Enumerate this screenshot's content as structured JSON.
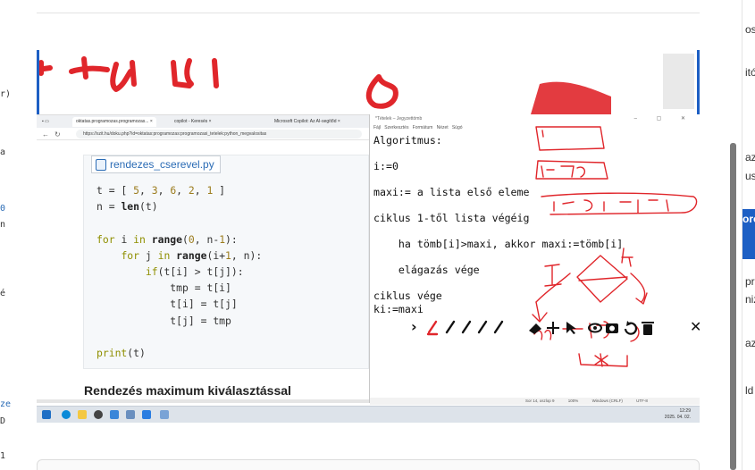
{
  "left_fragments": [
    {
      "text": "r)"
    },
    {
      "text": "a"
    },
    {
      "text": "0"
    },
    {
      "text": "n"
    },
    {
      "text": "é"
    },
    {
      "text": "ze"
    },
    {
      "text": "D"
    },
    {
      "text": "1"
    }
  ],
  "right_sidebar": {
    "items": [
      "os",
      "itó",
      "az",
      "us",
      "oro",
      "pr",
      "niz",
      "aza",
      "ld"
    ]
  },
  "browser": {
    "tabs": [
      {
        "label": "oktatas.programozas.programozas...",
        "close": "×"
      },
      {
        "label": "copilot - Keresés",
        "close": "×"
      },
      {
        "label": "Microsoft Copilot: Az AI-segítőd",
        "close": "×"
      }
    ],
    "url": "https://szit.hu/doku.php?id=oktatas:programozas:programozasi_tetelek:python_megvalositas",
    "filename": "rendezes_cserevel.py",
    "heading": "Rendezés maximum kiválasztással"
  },
  "code_lines": [
    "t = [ 5, 3, 6, 2, 1 ]",
    "n = len(t)",
    "",
    "for i in range(0, n-1):",
    "    for j in range(i+1, n):",
    "        if(t[i] > t[j]):",
    "            tmp = t[i]",
    "            t[i] = t[j]",
    "            t[j] = tmp",
    "",
    "print(t)"
  ],
  "notepad": {
    "title": "*Tételek – Jegyzettömb",
    "window_buttons": "–  ▢  ✕",
    "menu": [
      "Fájl",
      "Szerkesztés",
      "Formátum",
      "Nézet",
      "Súgó"
    ],
    "lines": [
      "Algoritmus:",
      "",
      "i:=0",
      "",
      "maxi:= a lista első eleme",
      "",
      "ciklus 1-től lista végéig",
      "",
      "    ha tömb[i]>maxi, akkor maxi:=tömb[i]",
      "",
      "    elágazás vége",
      "",
      "ciklus vége",
      "ki:=maxi"
    ],
    "status": {
      "position": "Sor 14, oszlop 9",
      "zoom": "100%",
      "line_ending": "Windows (CRLF)",
      "encoding": "UTF-8"
    }
  },
  "annotation_toolbar": {
    "chevron": "›",
    "close": "✕"
  },
  "taskbar": {
    "time": "12:29",
    "date": "2025. 04. 02."
  },
  "colors": {
    "ink_red": "#e0262b",
    "accent_blue": "#1d5fc4",
    "code_keyword": "#8f8f00"
  }
}
